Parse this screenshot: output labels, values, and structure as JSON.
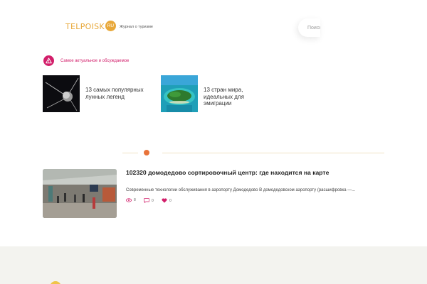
{
  "header": {
    "logo_text": "TELPOISK",
    "logo_tld": "RU",
    "tagline": "Журнал о туризме",
    "search_placeholder": "Поиск"
  },
  "section": {
    "title": "Самое актуальное и обсуждаемое",
    "icon": "warning-triangle-icon"
  },
  "popular": [
    {
      "title": "13 самых популярных лунных легенд",
      "image": "satellite-image"
    },
    {
      "title": "13 стран мира, идеальных для эмиграции",
      "image": "tropical-island-image"
    }
  ],
  "article": {
    "title": "102320 домодедово сортировочный центр: где находится на карте",
    "excerpt": "Современные технологии обслуживания в аэропорту Домодедово В домодедовском аэропорту (расшифровка —...",
    "views": "8",
    "comments": "0",
    "likes": "0",
    "image": "airport-hall-image"
  },
  "colors": {
    "accent": "#d21e6a",
    "logo": "#e8a83a",
    "divider_dot": "#e8733a",
    "footer_bg": "#f3f3ef"
  }
}
